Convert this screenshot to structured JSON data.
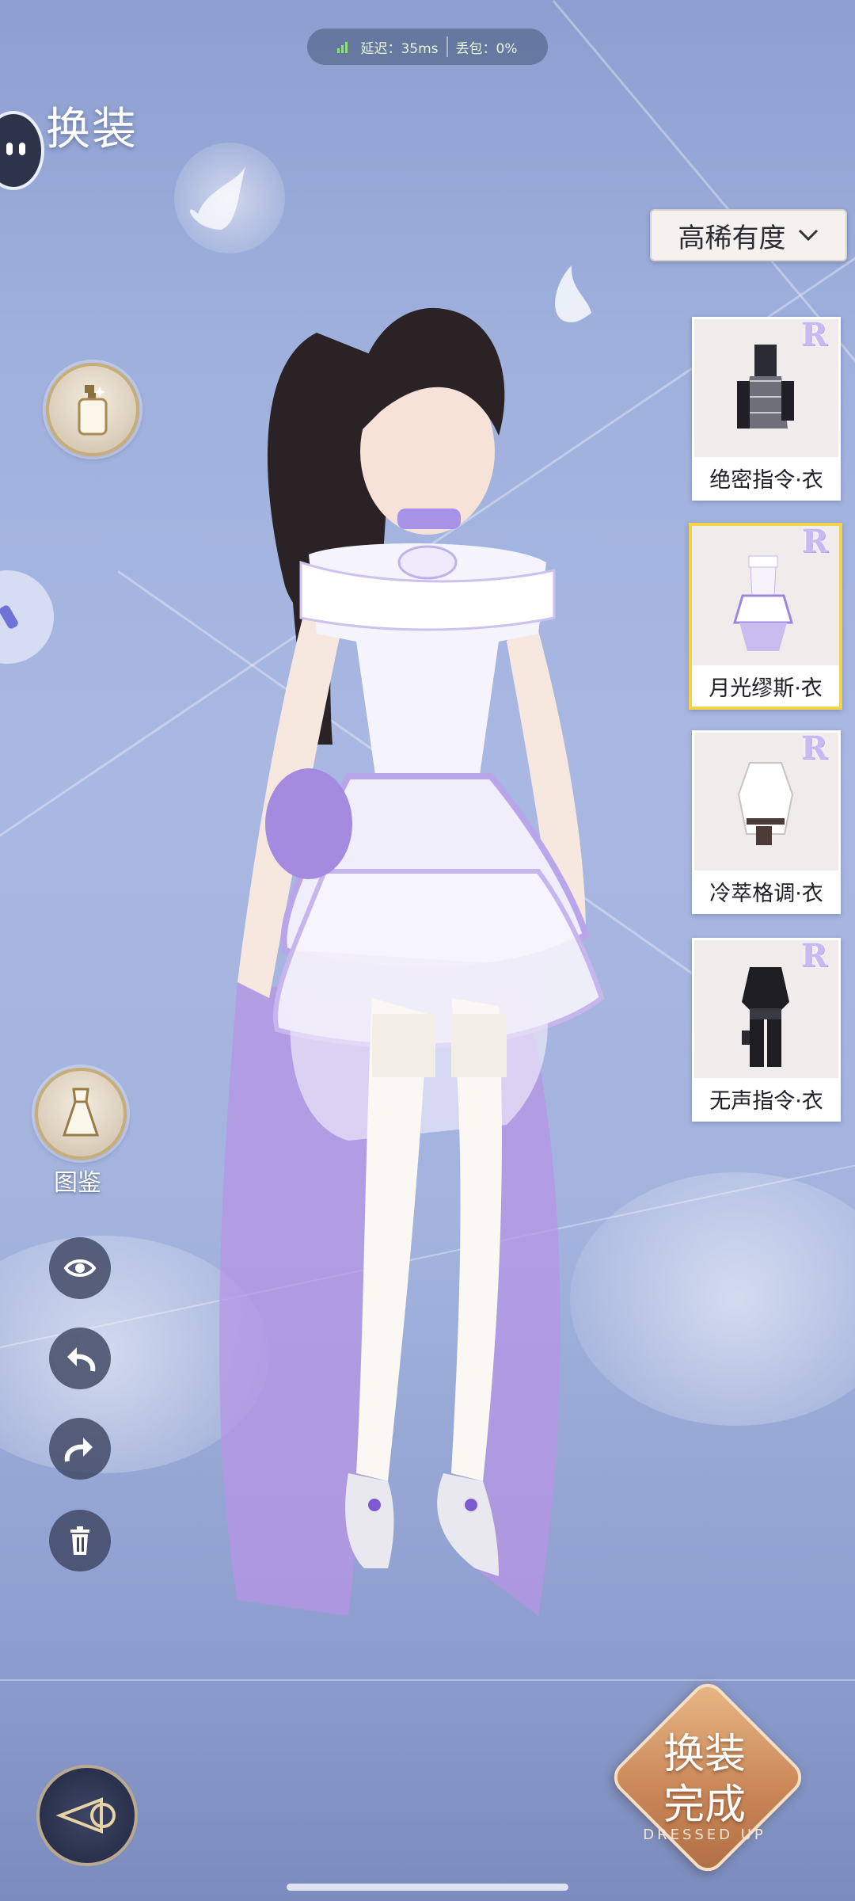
{
  "status": {
    "latency": "延迟：35ms",
    "packet_loss": "丢包：0%"
  },
  "header": {
    "title": "换装"
  },
  "filter": {
    "label": "高稀有度",
    "chevron": "chevron-down-icon"
  },
  "left_toolbar": {
    "cosmetics_icon": "lotion-bottle-icon",
    "codex_label": "图鉴",
    "codex_icon": "dress-icon",
    "actions": [
      {
        "name": "eye-icon"
      },
      {
        "name": "undo-icon"
      },
      {
        "name": "redo-icon"
      },
      {
        "name": "trash-icon"
      }
    ]
  },
  "outfits": [
    {
      "rarity": "R",
      "name": "绝密指令·衣",
      "selected": false,
      "palette": [
        "#2b2b33",
        "#8a8a96",
        "#ffffff"
      ]
    },
    {
      "rarity": "R",
      "name": "月光缪斯·衣",
      "selected": true,
      "palette": [
        "#ffffff",
        "#c7b6ee",
        "#9b86e0"
      ]
    },
    {
      "rarity": "R",
      "name": "冷萃格调·衣",
      "selected": false,
      "palette": [
        "#ffffff",
        "#4b3a35",
        "#d9d4d2"
      ]
    },
    {
      "rarity": "R",
      "name": "无声指令·衣",
      "selected": false,
      "palette": [
        "#1d1d22",
        "#3a3a42",
        "#6a6a72"
      ]
    }
  ],
  "done_button": {
    "line1": "换装",
    "line2": "完成",
    "sub": "DRESSED UP"
  },
  "colors": {
    "accent_gold": "#f3d34a",
    "panel_dark": "#3e4662",
    "background": "#a3b3de"
  }
}
